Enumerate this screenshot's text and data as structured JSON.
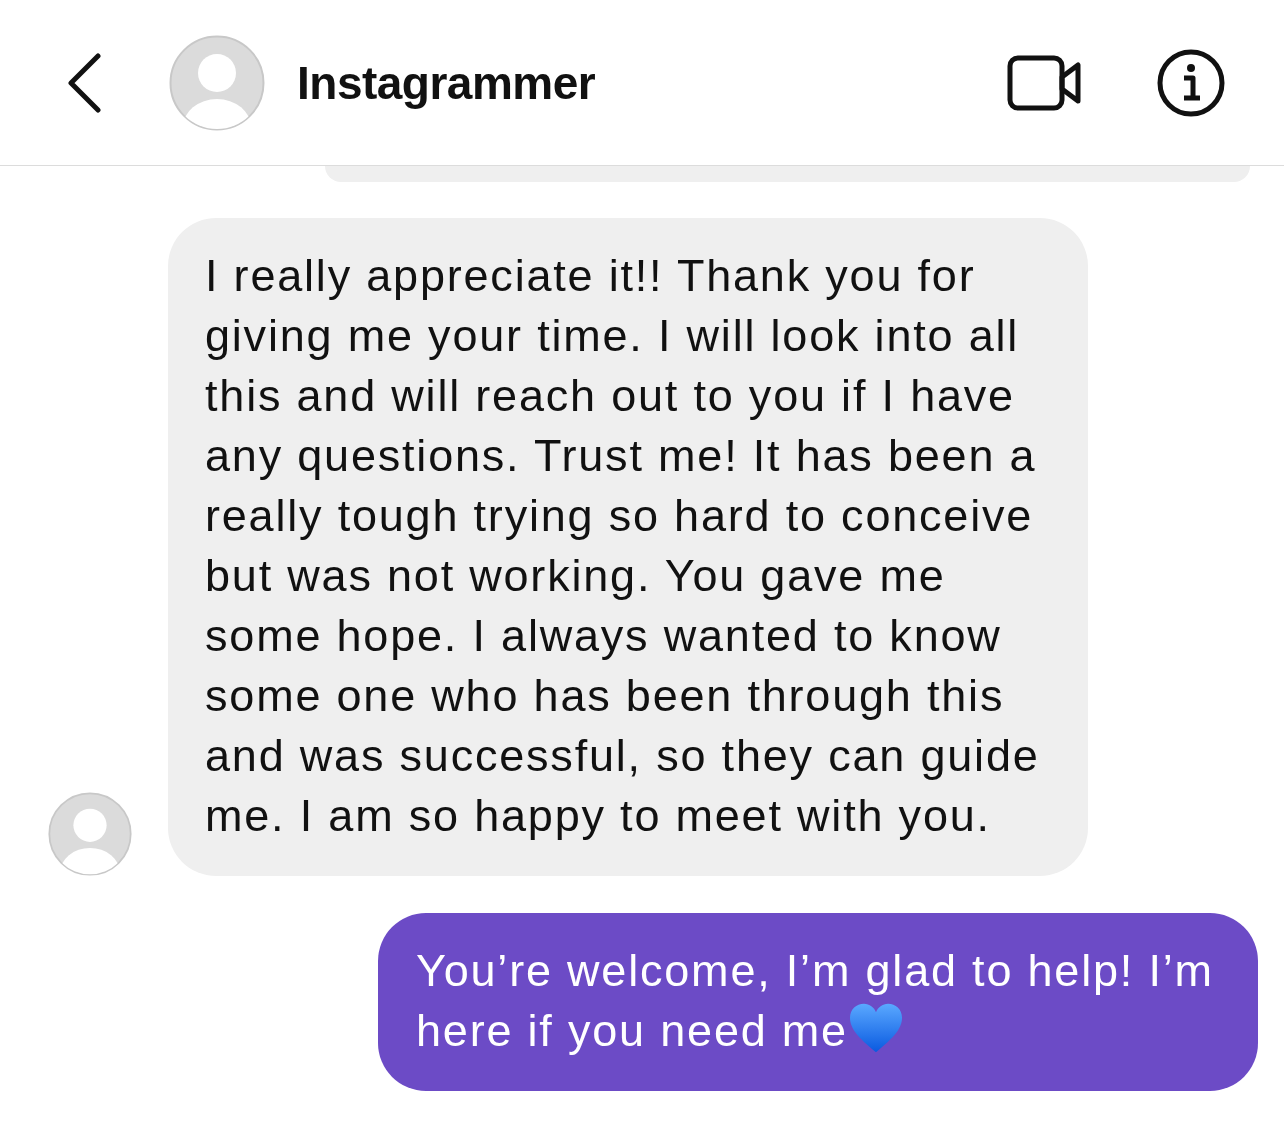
{
  "header": {
    "title": "Instagrammer"
  },
  "messages": [
    {
      "kind": "received",
      "text": "I really appreciate it!! Thank you for giving me your time. I will look into all this and will reach out to you if I have any questions. Trust me! It has been a really tough trying so hard to conceive but was not working. You gave me some hope. I always wanted to know some one who has been through this and was successful, so they can guide me. I am so happy to meet with you."
    },
    {
      "kind": "sent",
      "text": "You’re welcome, I’m glad to help! I’m here if you need me",
      "heart_emoji": true
    }
  ]
}
